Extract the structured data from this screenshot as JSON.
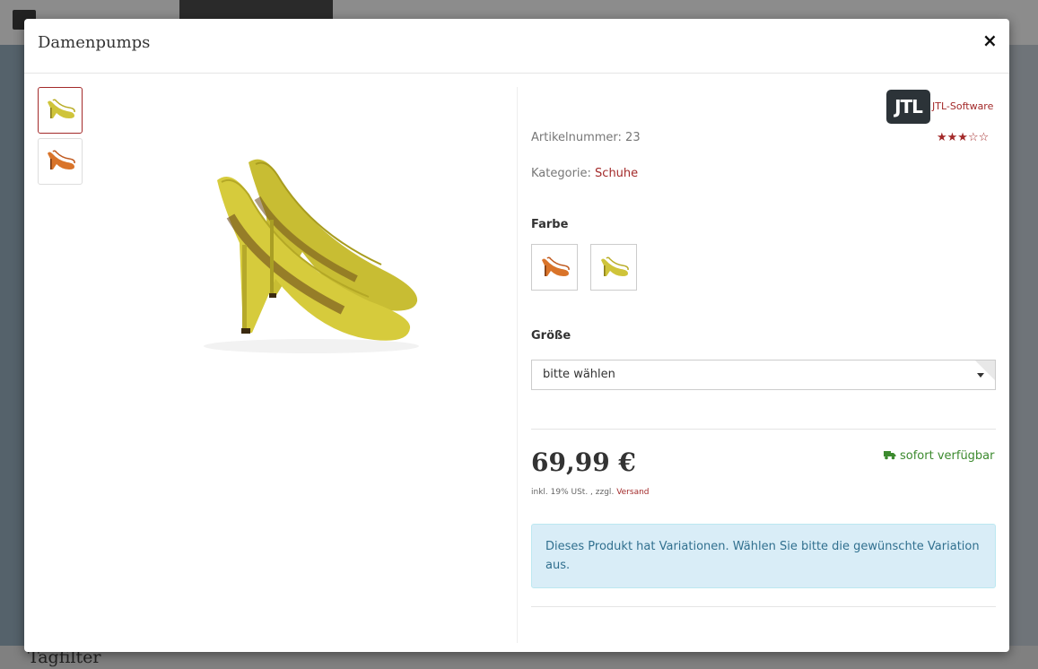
{
  "background": {
    "section_heading": "Tagfilter"
  },
  "modal": {
    "title": "Damenpumps",
    "close_label": "×"
  },
  "product": {
    "brand_logo_text": "JTL",
    "brand_name": "JTL-Software",
    "article_number_text": "Artikelnummer: 23",
    "rating": {
      "value": 3,
      "max": 5,
      "stars_filled": "★★★",
      "stars_empty": "☆☆"
    },
    "category_label": "Kategorie:",
    "category_value": "Schuhe",
    "color_label": "Farbe",
    "size_label": "Größe",
    "size_select_value": "bitte wählen",
    "price": "69,99 €",
    "price_note_prefix": "inkl. 19% USt. , zzgl.",
    "shipping_link": "Versand",
    "availability": "sofort verfügbar",
    "variation_notice": "Dieses Produkt hat Variationen. Wählen Sie bitte die gewünschte Variation aus."
  },
  "colors": {
    "accent": "#a32a2a",
    "yellow_shoe": "#cfc43a",
    "orange_shoe": "#d9742a",
    "available": "#3c8a2e",
    "info_bg": "#d9edf7",
    "info_text": "#31708f"
  },
  "icons": {
    "close": "close-icon",
    "truck": "truck-icon",
    "caret": "chevron-down-icon"
  }
}
